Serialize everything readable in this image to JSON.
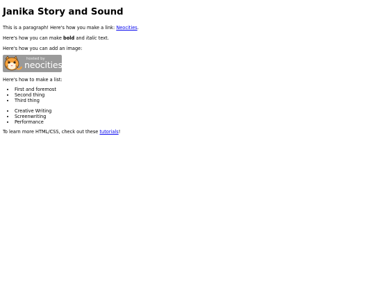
{
  "title": "Janika Story and Sound",
  "para1": {
    "text": "This is a paragraph! Here's how you make a link: ",
    "link": "Neocities",
    "after": "."
  },
  "para2": {
    "before": "Here's how you can make ",
    "bold": "bold",
    "middle": " and ",
    "italic": "italic",
    "after": " text."
  },
  "para3": "Here's how you can add an image:",
  "badge": {
    "line1": "hosted by",
    "line2": "neocities",
    "icon": "neocities-cat-icon"
  },
  "para4": "Here's how to make a list:",
  "list1": [
    "First and foremost",
    "Second thing",
    "Third thing"
  ],
  "list2": [
    "Creative Writing",
    "Screenwriting",
    "Performance"
  ],
  "para5": {
    "text": "To learn more HTML/CSS, check out these ",
    "link": "tutorials",
    "after": "!"
  },
  "colors": {
    "link": "#0000ee",
    "badge_bg": "#9a9a9a"
  }
}
